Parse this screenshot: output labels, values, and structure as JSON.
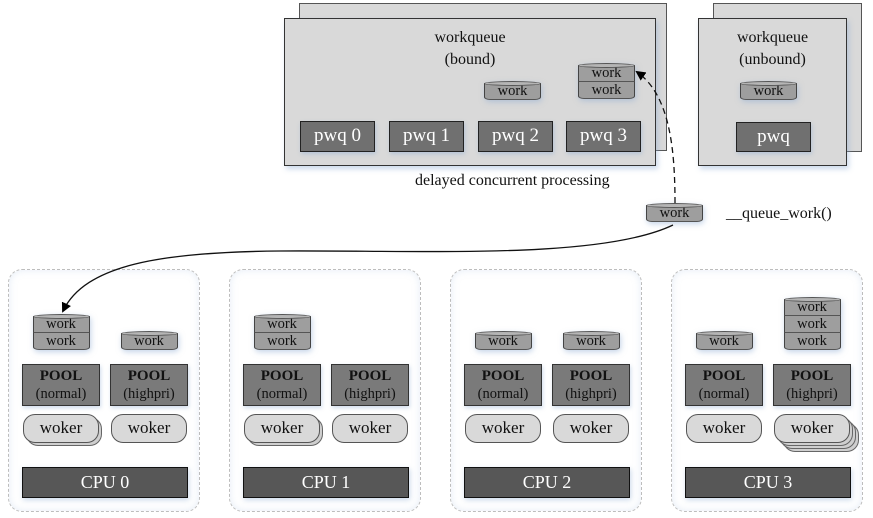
{
  "bound_workqueue": {
    "title_line1": "workqueue",
    "title_line2": "(bound)",
    "pwqs": [
      "pwq 0",
      "pwq 1",
      "pwq 2",
      "pwq 3"
    ],
    "pending_work": {
      "pwq 2": [
        "work"
      ],
      "pwq 3": [
        "work",
        "work"
      ]
    }
  },
  "unbound_workqueue": {
    "title_line1": "workqueue",
    "title_line2": "(unbound)",
    "pwq": "pwq",
    "pending_work": [
      "work"
    ]
  },
  "labels": {
    "delayed": "delayed concurrent processing",
    "queue_fn": "__queue_work()",
    "incoming_work": "work"
  },
  "cpus": [
    {
      "name": "CPU 0",
      "normal_pool": {
        "title": "POOL",
        "sub": "(normal)",
        "works": [
          "work",
          "work"
        ],
        "worker": "woker",
        "worker_count": 2
      },
      "highpri_pool": {
        "title": "POOL",
        "sub": "(highpri)",
        "works": [
          "work"
        ],
        "worker": "woker",
        "worker_count": 1
      }
    },
    {
      "name": "CPU 1",
      "normal_pool": {
        "title": "POOL",
        "sub": "(normal)",
        "works": [
          "work",
          "work"
        ],
        "worker": "woker",
        "worker_count": 2
      },
      "highpri_pool": {
        "title": "POOL",
        "sub": "(highpri)",
        "works": [],
        "worker": "woker",
        "worker_count": 1
      }
    },
    {
      "name": "CPU 2",
      "normal_pool": {
        "title": "POOL",
        "sub": "(normal)",
        "works": [
          "work"
        ],
        "worker": "woker",
        "worker_count": 1
      },
      "highpri_pool": {
        "title": "POOL",
        "sub": "(highpri)",
        "works": [
          "work"
        ],
        "worker": "woker",
        "worker_count": 1
      }
    },
    {
      "name": "CPU 3",
      "normal_pool": {
        "title": "POOL",
        "sub": "(normal)",
        "works": [
          "work"
        ],
        "worker": "woker",
        "worker_count": 1
      },
      "highpri_pool": {
        "title": "POOL",
        "sub": "(highpri)",
        "works": [
          "work",
          "work",
          "work"
        ],
        "worker": "woker",
        "worker_count": 4
      }
    }
  ]
}
